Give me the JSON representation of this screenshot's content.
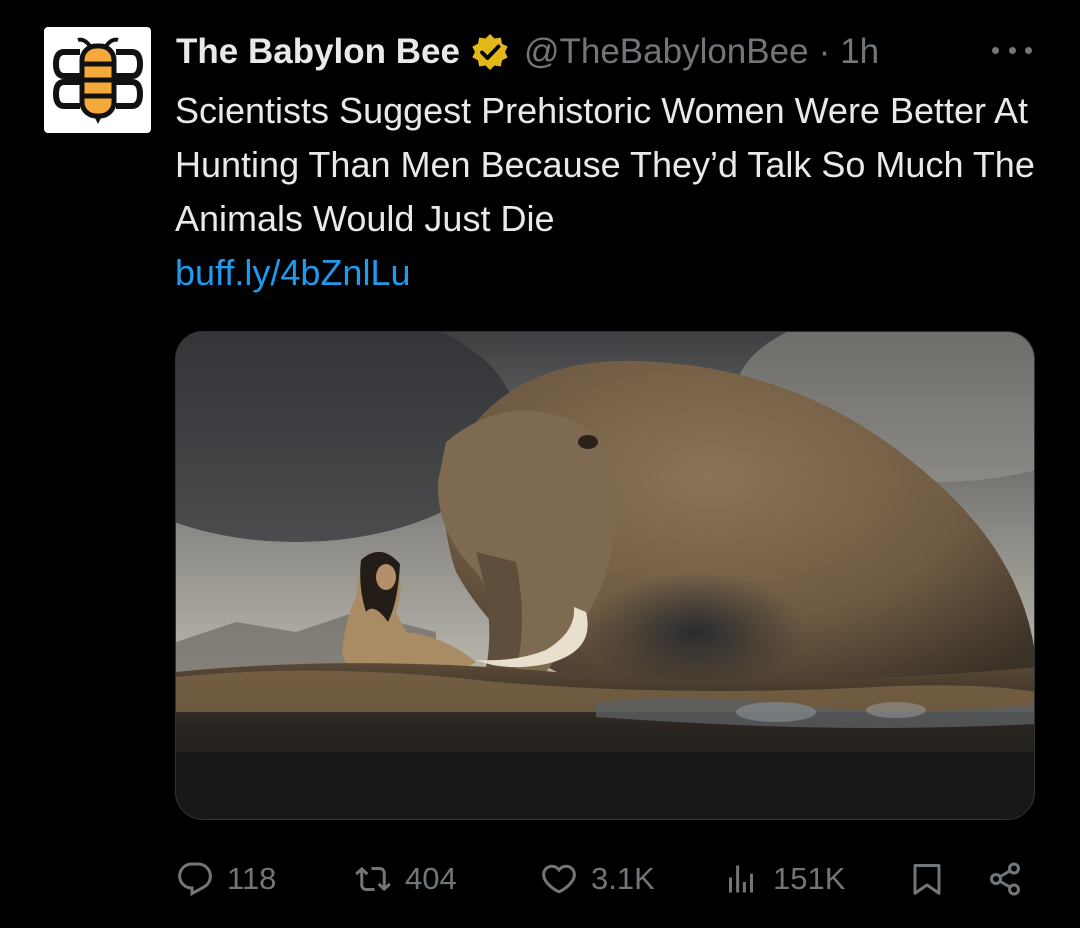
{
  "author": {
    "display_name": "The Babylon Bee",
    "handle": "@TheBabylonBee",
    "separator": "·",
    "time": "1h",
    "verified_icon": "verified-badge-icon"
  },
  "tweet": {
    "text": "Scientists Suggest Prehistoric Women Were Better At Hunting Than Men Because They’d Talk So Much The Animals Would Just Die",
    "link": "buff.ly/4bZnlLu",
    "media_alt": "Painting of a prehistoric woman seated in front of a giant woolly mammoth"
  },
  "actions": {
    "replies": "118",
    "reposts": "404",
    "likes": "3.1K",
    "views": "151K"
  },
  "colors": {
    "background": "#000000",
    "text": "#e7e9ea",
    "muted": "#71767b",
    "link": "#1d9bf0",
    "verified": "#e2b719",
    "logo_bee": "#f4a93a"
  }
}
